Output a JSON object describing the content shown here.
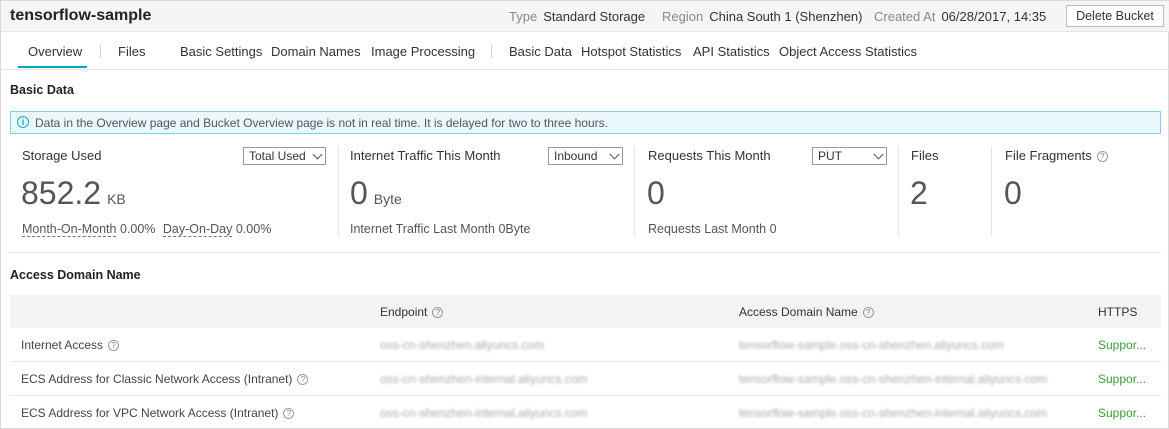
{
  "header": {
    "title": "tensorflow-sample",
    "type_label": "Type",
    "type_value": "Standard Storage",
    "region_label": "Region",
    "region_value": "China South 1 (Shenzhen)",
    "created_label": "Created At",
    "created_value": "06/28/2017, 14:35",
    "delete_button": "Delete Bucket"
  },
  "tabs": [
    {
      "label": "Overview",
      "active": true
    },
    {
      "label": "Files"
    },
    {
      "label": "Basic Settings"
    },
    {
      "label": "Domain Names"
    },
    {
      "label": "Image Processing"
    },
    {
      "label": "Basic Data"
    },
    {
      "label": "Hotspot Statistics"
    },
    {
      "label": "API Statistics"
    },
    {
      "label": "Object Access Statistics"
    }
  ],
  "basic_data": {
    "title": "Basic Data",
    "notice": "Data in the Overview page and Bucket Overview page is not in real time. It is delayed for two to three hours.",
    "storage": {
      "label": "Storage Used",
      "select": "Total Used",
      "value": "852.2",
      "unit": "KB",
      "mom_label": "Month-On-Month",
      "mom_value": "0.00%",
      "dod_label": "Day-On-Day",
      "dod_value": "0.00%"
    },
    "traffic": {
      "label": "Internet Traffic This Month",
      "select": "Inbound",
      "value": "0",
      "unit": "Byte",
      "last_month": "Internet Traffic Last Month 0Byte"
    },
    "requests": {
      "label": "Requests This Month",
      "select": "PUT",
      "value": "0",
      "last_month": "Requests Last Month 0"
    },
    "files": {
      "label": "Files",
      "value": "2"
    },
    "fragments": {
      "label": "File Fragments",
      "value": "0"
    }
  },
  "access": {
    "title": "Access Domain Name",
    "columns": [
      "",
      "Endpoint",
      "Access Domain Name",
      "HTTPS"
    ],
    "rows": [
      {
        "name": "Internet Access",
        "endpoint": "oss-cn-shenzhen.aliyuncs.com",
        "domain": "tensorflow-sample.oss-cn-shenzhen.aliyuncs.com",
        "https": "Suppor..."
      },
      {
        "name": "ECS Address for Classic Network Access (Intranet)",
        "endpoint": "oss-cn-shenzhen-internal.aliyuncs.com",
        "domain": "tensorflow-sample.oss-cn-shenzhen-internal.aliyuncs.com",
        "https": "Suppor..."
      },
      {
        "name": "ECS Address for VPC Network Access (Intranet)",
        "endpoint": "oss-cn-shenzhen-internal.aliyuncs.com",
        "domain": "tensorflow-sample.oss-cn-shenzhen-internal.aliyuncs.com",
        "https": "Suppor..."
      }
    ]
  },
  "colors": {
    "accent": "#00a2ca",
    "notice_bg": "#eaf7fb",
    "support_green": "#3a9d3a"
  }
}
